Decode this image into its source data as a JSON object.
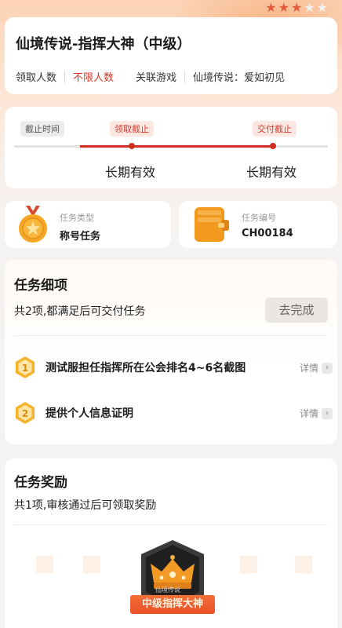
{
  "header": {
    "rating": 3,
    "rating_max": 5,
    "title": "仙境传说-指挥大神（中级）",
    "claim_count_label": "领取人数",
    "claim_count_value": "不限人数",
    "related_game_label": "关联游戏",
    "related_game_value": "仙境传说：爱如初见"
  },
  "deadline": {
    "start_label": "截止时间",
    "claim_label": "领取截止",
    "submit_label": "交付截止",
    "claim_value": "长期有效",
    "submit_value": "长期有效"
  },
  "info": {
    "type_label": "任务类型",
    "type_value": "称号任务",
    "id_label": "任务编号",
    "id_value": "CH00184"
  },
  "tasks": {
    "title": "任务细项",
    "subtitle": "共2项,都满足后可交付任务",
    "go_button": "去完成",
    "items": [
      {
        "num": "1",
        "text": "测试服担任指挥所在公会排名4~6名截图",
        "detail": "详情"
      },
      {
        "num": "2",
        "text": "提供个人信息证明",
        "detail": "详情"
      }
    ]
  },
  "rewards": {
    "title": "任务奖励",
    "subtitle": "共1项,审核通过后可领取奖励",
    "badge_label": "中级指挥大神",
    "badge_sub": "仙境传说"
  },
  "colors": {
    "accent": "#d43b2c",
    "star_on": "#e25b3a",
    "badge": "#ea4f25"
  }
}
